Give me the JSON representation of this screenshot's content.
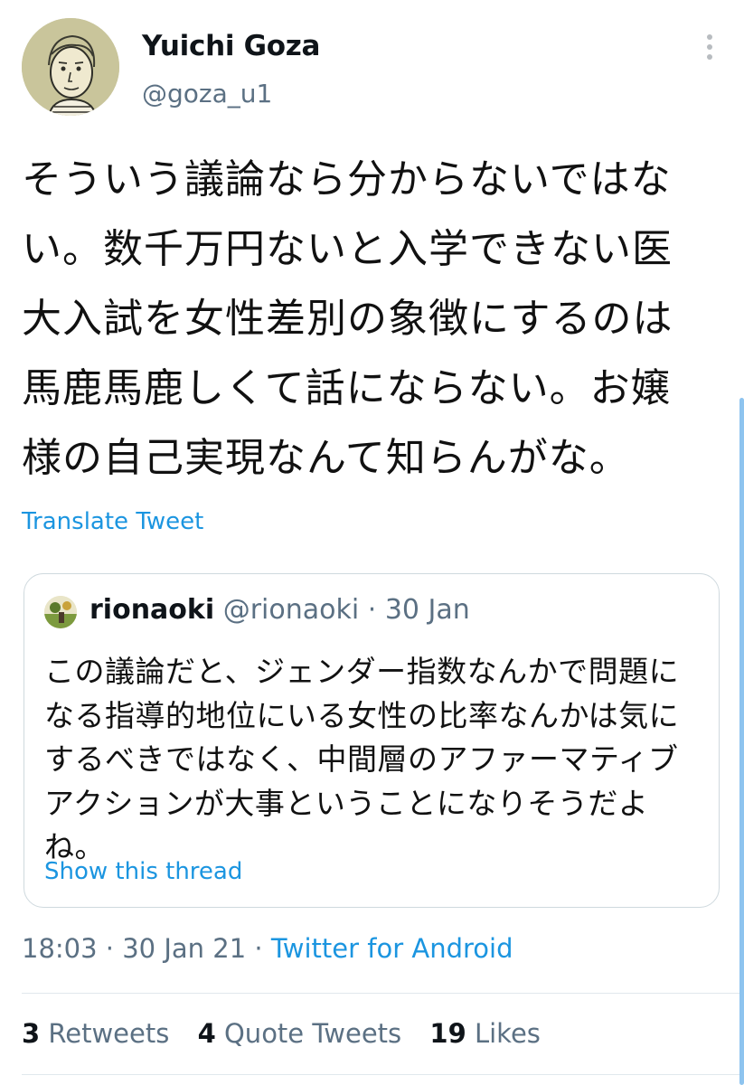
{
  "author": {
    "display_name": "Yuichi Goza",
    "handle": "@goza_u1",
    "avatar_icon": "user-avatar-sketch"
  },
  "more_icon": "vertical-dots-icon",
  "tweet": {
    "text": "そういう議論なら分からないではな\nい。数千万円ないと入学できない医\n大入試を女性差別の象徴にするのは\n馬鹿馬鹿しくて話にならない。お嬢\n様の自己実現なんて知らんがな。",
    "translate_label": "Translate Tweet"
  },
  "quoted": {
    "name": "rionaoki",
    "handle": "@rionaoki",
    "separator": "·",
    "date": "30 Jan",
    "text": "この議論だと、ジェンダー指数なんかで問題に\nなる指導的地位にいる女性の比率なんかは気に\nするべきではなく、中間層のアファーマティブ\nアクションが大事ということになりそうだよ\nね。",
    "show_thread_label": "Show this thread"
  },
  "meta": {
    "time": "18:03",
    "separator": "·",
    "date": "30 Jan 21",
    "source": "Twitter for Android"
  },
  "stats": {
    "retweets": {
      "count": "3",
      "label": "Retweets"
    },
    "quotes": {
      "count": "4",
      "label": "Quote Tweets"
    },
    "likes": {
      "count": "19",
      "label": "Likes"
    }
  },
  "colors": {
    "link": "#1b95e0",
    "secondary_text": "#5b7083",
    "border": "#cfd9de"
  }
}
